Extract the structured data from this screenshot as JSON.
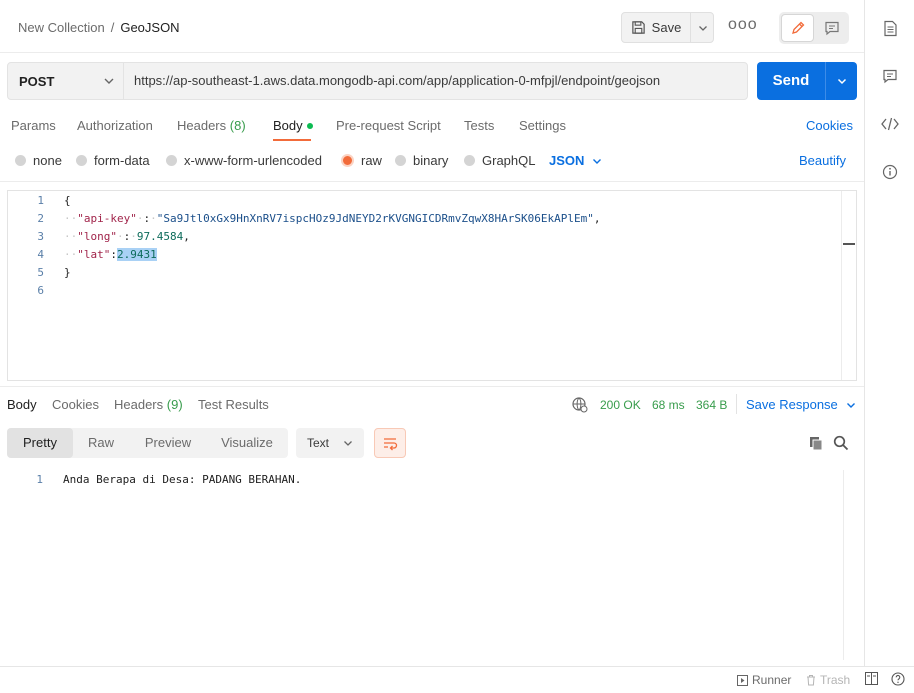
{
  "breadcrumb": {
    "parent": "New Collection",
    "separator": "/",
    "current": "GeoJSON"
  },
  "toolbar": {
    "save_label": "Save",
    "more_label": "ooo"
  },
  "request": {
    "method": "POST",
    "url": "https://ap-southeast-1.aws.data.mongodb-api.com/app/application-0-mfpjl/endpoint/geojson",
    "send_label": "Send"
  },
  "request_tabs": {
    "params": "Params",
    "authorization": "Authorization",
    "headers": "Headers",
    "headers_count": "(8)",
    "body": "Body",
    "prerequest": "Pre-request Script",
    "tests": "Tests",
    "settings": "Settings",
    "cookies": "Cookies"
  },
  "body_types": {
    "none": "none",
    "form_data": "form-data",
    "urlencoded": "x-www-form-urlencoded",
    "raw": "raw",
    "binary": "binary",
    "graphql": "GraphQL",
    "language": "JSON",
    "beautify": "Beautify"
  },
  "editor": {
    "line_numbers": [
      "1",
      "2",
      "3",
      "4",
      "5",
      "6"
    ],
    "l1_open": "{",
    "l2_key": "\"api-key\"",
    "l2_colon": ":",
    "l2_value": "\"Sa9Jtl0xGx9HnXnRV7ispcHOz9JdNEYD2rKVGNGICDRmvZqwX8HArSK06EkAPlEm\"",
    "l2_comma": ",",
    "l3_key": "\"long\"",
    "l3_colon": ":",
    "l3_value": "97.4584",
    "l3_comma": ",",
    "l4_key": "\"lat\"",
    "l4_colon": ":",
    "l4_value": "2.9431",
    "l5_close": "}"
  },
  "response_tabs": {
    "body": "Body",
    "cookies": "Cookies",
    "headers": "Headers",
    "headers_count": "(9)",
    "test_results": "Test Results"
  },
  "response_meta": {
    "status": "200 OK",
    "time": "68 ms",
    "size": "364 B",
    "save_response": "Save Response"
  },
  "view_modes": {
    "pretty": "Pretty",
    "raw": "Raw",
    "preview": "Preview",
    "visualize": "Visualize",
    "format": "Text"
  },
  "response_body": {
    "line_number": "1",
    "text": "Anda Berapa di Desa: PADANG BERAHAN."
  },
  "statusbar": {
    "runner": "Runner",
    "trash": "Trash"
  },
  "colors": {
    "accent": "#0A6FE0",
    "active_tab": "#F26B3A",
    "success": "#389C4C",
    "indicator": "#0CBB52"
  }
}
